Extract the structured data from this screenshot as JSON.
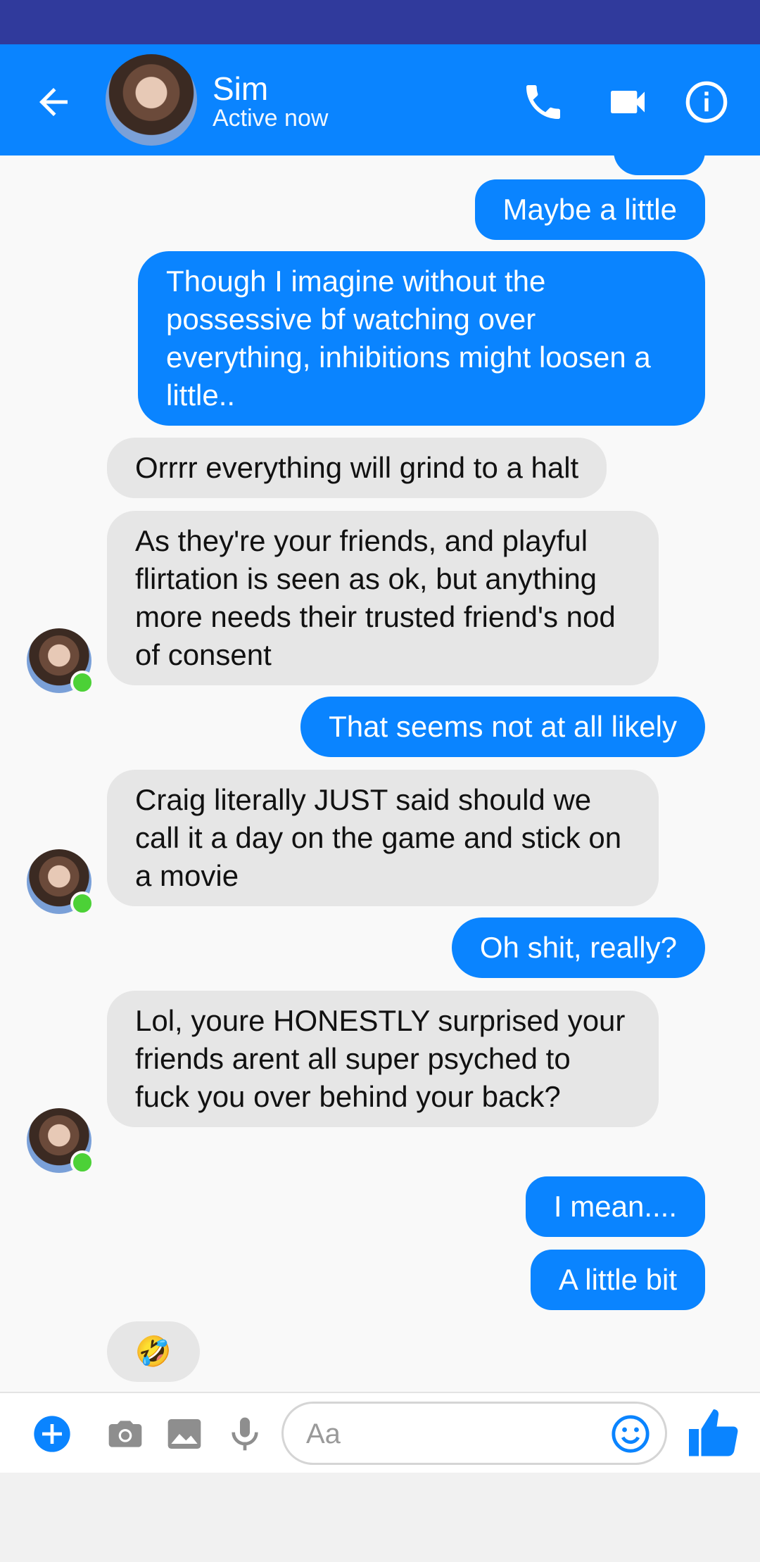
{
  "header": {
    "name": "Sim",
    "status": "Active now"
  },
  "messages": [
    {
      "dir": "out",
      "text": "Maybe a little"
    },
    {
      "dir": "out",
      "text": "Though I imagine without the possessive bf watching over everything, inhibitions might loosen a little.."
    },
    {
      "dir": "in",
      "text": "Orrrr everything will grind to a halt"
    },
    {
      "dir": "in",
      "text": "As they're your friends, and playful flirtation is seen as ok, but anything more needs their trusted friend's nod of consent"
    },
    {
      "dir": "out",
      "text": "That seems not at all likely"
    },
    {
      "dir": "in",
      "text": "Craig literally JUST said should we call it a day on the game and stick on a movie"
    },
    {
      "dir": "out",
      "text": "Oh shit, really?"
    },
    {
      "dir": "in",
      "text": "Lol, youre HONESTLY surprised your friends arent all super psyched to fuck you over behind your back?"
    },
    {
      "dir": "out",
      "text": "I mean...."
    },
    {
      "dir": "out",
      "text": "A little bit"
    },
    {
      "dir": "in",
      "text": "🤣"
    }
  ],
  "composer": {
    "placeholder": "Aa"
  },
  "icons": {
    "back": "arrow-left-icon",
    "call": "phone-icon",
    "video": "video-camera-icon",
    "info": "info-icon",
    "plus": "plus-circle-icon",
    "camera": "camera-icon",
    "gallery": "image-icon",
    "mic": "microphone-icon",
    "emoji": "smiley-icon",
    "like": "thumbs-up-icon"
  },
  "colors": {
    "brand": "#0a84ff",
    "status_bar": "#303a9c",
    "incoming_bubble": "#e6e6e6",
    "online": "#4cd137"
  }
}
